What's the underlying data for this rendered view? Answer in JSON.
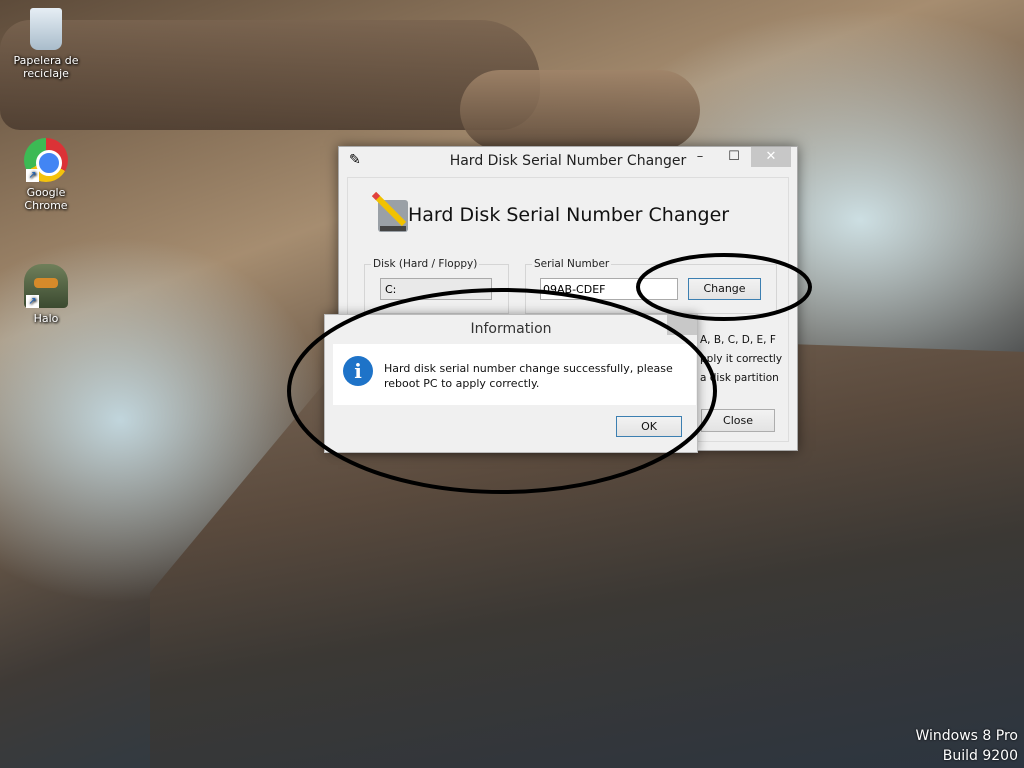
{
  "desktop": {
    "icons": [
      {
        "label": "Papelera de reciclaje",
        "icon": "recycle-bin-icon"
      },
      {
        "label": "Google Chrome",
        "icon": "chrome-icon"
      },
      {
        "label": "Halo",
        "icon": "halo-icon"
      }
    ],
    "watermark": {
      "line1": "Windows 8 Pro",
      "line2": "Build 9200"
    }
  },
  "window": {
    "title": "Hard Disk Serial Number Changer",
    "heading": "Hard Disk Serial Number Changer",
    "disk_group": "Disk (Hard / Floppy)",
    "disk_value": "C:",
    "serial_group": "Serial Number",
    "serial_value": "09AB-CDEF",
    "change_label": "Change",
    "close_label": "Close",
    "hint_lines": [
      "A, B, C, D, E, F",
      "pply it correctly",
      "a disk partition"
    ]
  },
  "dialog": {
    "title": "Information",
    "message": "Hard disk serial number change successfully, please reboot PC to apply correctly.",
    "ok_label": "OK"
  }
}
